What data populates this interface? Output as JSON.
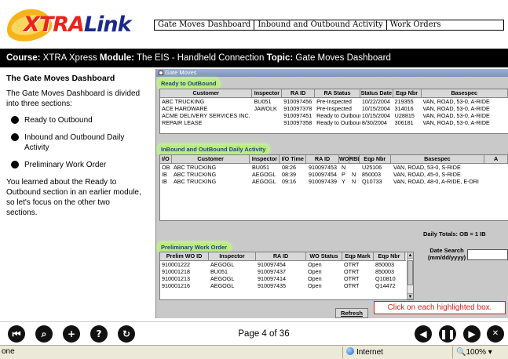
{
  "logo": {
    "xtra": "XTRA",
    "link": "Link"
  },
  "top_tabs": [
    "Gate Moves Dashboard",
    "Inbound and Outbound Activity",
    "Work Orders"
  ],
  "course_bar": {
    "course_label": "Course:",
    "course": "XTRA Xpress",
    "module_label": "Module:",
    "module": "The EIS - Handheld Connection",
    "topic_label": "Topic:",
    "topic": "Gate Moves Dashboard"
  },
  "left_panel": {
    "heading": "The Gate Moves Dashboard",
    "intro": "The Gate Moves Dashboard is divided into three sections:",
    "bullets": [
      "Ready to Outbound",
      "Inbound and Outbound Daily Activity",
      "Preliminary Work Order"
    ],
    "outro": "You learned about the Ready to Outbound section in an earlier module, so let's focus on the other two sections."
  },
  "app": {
    "window_title": "Gate Moves",
    "ready": {
      "title": "Ready to OutBound",
      "headers": [
        "Customer",
        "Inspector",
        "RA ID",
        "RA Status",
        "Status Date",
        "Eqp Nbr",
        "Basespec"
      ],
      "rows": [
        [
          "ABC TRUCKING",
          "BU051",
          "910097456",
          "Pre-Inspected",
          "10/22/2004",
          "219355",
          "VAN, ROAD, 53-0, A-RIDE"
        ],
        [
          "ACE HARDWARE",
          "JAWOLK",
          "910097378",
          "Pre-Inspected",
          "10/15/2004",
          "314016",
          "VAN, ROAD, 53-0, A-RIDE"
        ],
        [
          "ACME DELIVERY SERVICES INC.",
          "",
          "910097451",
          "Ready to Outbound",
          "10/15/2004",
          "U28815",
          "VAN, ROAD, 53-0, A-RIDE"
        ],
        [
          "REPAIR LEASE",
          "",
          "910097358",
          "Ready to Outbound",
          "8/30/2004",
          "306181",
          "VAN, ROAD, 53-0, A-RIDE"
        ]
      ]
    },
    "daily": {
      "title": "InBound and OutBound Daily Activity",
      "headers": [
        "I/O",
        "Customer",
        "Inspector",
        "I/O Time",
        "RA ID",
        "WO",
        "RBL",
        "Eqp Nbr",
        "Basespec",
        "A"
      ],
      "rows": [
        [
          "OB",
          "ABC TRUCKING",
          "BU051",
          "08:26",
          "910097453",
          "N",
          "",
          "U25106",
          "VAN, ROAD, 53-0, S-RIDE"
        ],
        [
          "IB",
          "ABC TRUCKING",
          "AEGOGL",
          "08:39",
          "910097454",
          "P",
          "N",
          "850003",
          "VAN, ROAD, 45-0, S-RIDE"
        ],
        [
          "IB",
          "ABC TRUCKING",
          "AEGOGL",
          "09:16",
          "910097439",
          "Y",
          "N",
          "Q10733",
          "VAN, ROAD, 48-0, A-RIDE, E-DRI"
        ]
      ],
      "totals": "Daily Totals:  OB =     1   IB"
    },
    "prelim": {
      "title": "Preliminary Work Order",
      "headers": [
        "Prelim WO ID",
        "Inspector",
        "RA ID",
        "WO Status",
        "Eqp Mark",
        "Eqp Nbr"
      ],
      "rows": [
        [
          "910001222",
          "AEGOGL",
          "910097454",
          "Open",
          "OTRT",
          "850003"
        ],
        [
          "910001218",
          "BU051",
          "910097437",
          "Open",
          "OTRT",
          "850003"
        ],
        [
          "910001213",
          "AEGOGL",
          "910097414",
          "Open",
          "OTRT",
          "Q10810"
        ],
        [
          "910001216",
          "AEGOGL",
          "910097435",
          "Open",
          "OTRT",
          "Q14472"
        ]
      ]
    },
    "date_search": "Date Search (mm/dd/yyyy)",
    "refresh": "Refresh"
  },
  "tip": "Click on each highlighted box.",
  "page": "Page 4 of 36",
  "status": {
    "left": "one",
    "zone": "Internet",
    "zoom": "100%"
  }
}
